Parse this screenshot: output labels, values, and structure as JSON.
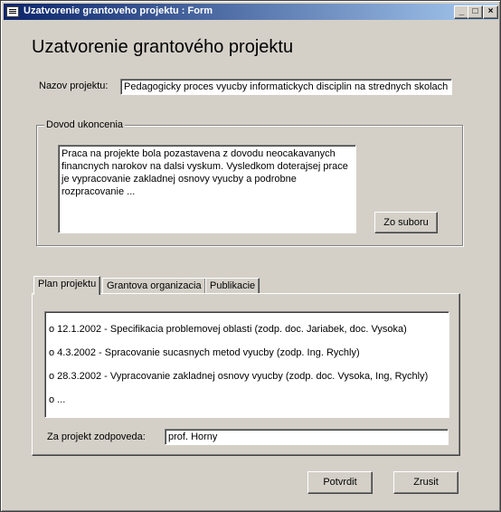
{
  "window": {
    "title": "Uzatvorenie grantoveho projektu : Form",
    "minimize": "_",
    "maximize": "□",
    "close": "×"
  },
  "form": {
    "title": "Uzatvorenie grantového projektu",
    "project_name_label": "Nazov projektu:",
    "project_name_value": "Pedagogicky proces vyucby informatickych disciplin na strednych skolach",
    "reason_group_label": "Dovod ukoncenia",
    "reason_text": "Praca na projekte bola pozastavena z dovodu neocakavanych\nfinancnych narokov na dalsi vyskum. Vysledkom doterajsej prace\nje vypracovanie zakladnej osnovy vyucby a podrobne\nrozpracovanie ...",
    "from_file_button": "Zo suboru"
  },
  "tabs": [
    {
      "label": "Plan projektu",
      "active": true
    },
    {
      "label": "Grantova organizacia",
      "active": false
    },
    {
      "label": "Publikacie",
      "active": false
    }
  ],
  "plan": {
    "items": [
      "o 12.1.2002  - Specifikacia problemovej oblasti (zodp. doc. Jariabek, doc. Vysoka)",
      "o 4.3.2002   - Spracovanie sucasnych metod vyucby (zodp. Ing. Rychly)",
      "o 28.3.2002  - Vypracovanie zakladnej osnovy vyucby (zodp. doc. Vysoka, Ing, Rychly)",
      "o ..."
    ],
    "responsible_label": "Za projekt zodpoveda:",
    "responsible_value": "prof. Horny"
  },
  "actions": {
    "confirm": "Potvrdit",
    "cancel": "Zrusit"
  }
}
